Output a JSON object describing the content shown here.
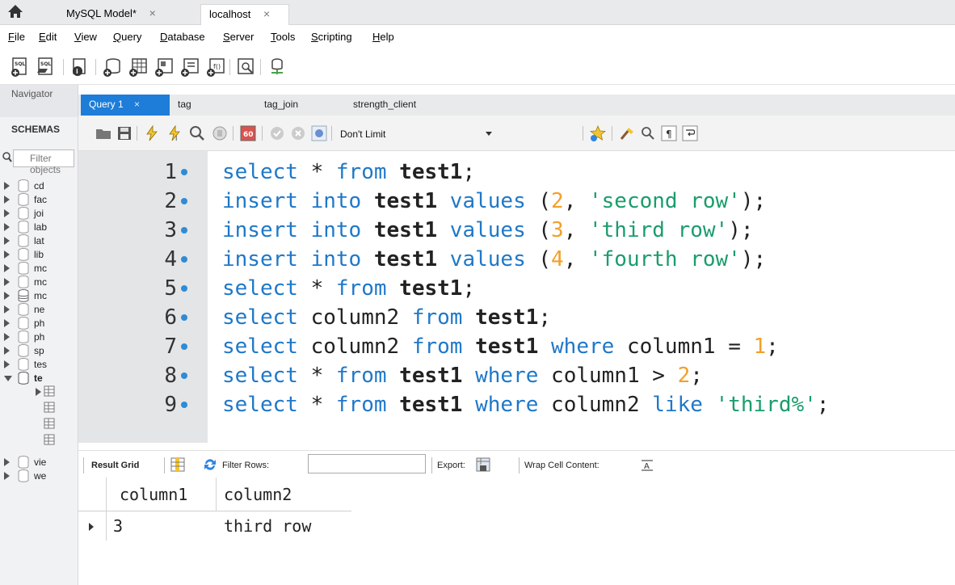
{
  "top_tabs": {
    "tabs": [
      {
        "label": "MySQL Model*",
        "close": "×"
      },
      {
        "label": "localhost",
        "close": "×"
      }
    ]
  },
  "menu": {
    "items": [
      "File",
      "Edit",
      "View",
      "Query",
      "Database",
      "Server",
      "Tools",
      "Scripting",
      "Help"
    ],
    "mnemonics": [
      "F",
      "E",
      "V",
      "Q",
      "D",
      "S",
      "T",
      "S",
      "H"
    ]
  },
  "navigator": {
    "header": "Navigator",
    "schemas_label": "SCHEMAS",
    "filter_placeholder": "Filter objects",
    "schemas": [
      "cd",
      "fac",
      "joi",
      "lab",
      "lat",
      "lib",
      "mc",
      "mc",
      "mc",
      "ne",
      "ph",
      "ph",
      "sp",
      "tes",
      "te",
      "vie",
      "we"
    ]
  },
  "query_tabs": {
    "tabs": [
      {
        "label": "Query 1",
        "close": "×",
        "active": true
      },
      {
        "label": "tag"
      },
      {
        "label": "tag_join"
      },
      {
        "label": "strength_client"
      }
    ]
  },
  "query_toolbar": {
    "limit_value": "Don't Limit"
  },
  "editor": {
    "lines": [
      {
        "n": "1",
        "tokens": [
          [
            "kw",
            "select"
          ],
          [
            "plain",
            " * "
          ],
          [
            "kw",
            "from"
          ],
          [
            "plain",
            " "
          ],
          [
            "id",
            "test1"
          ],
          [
            "plain",
            ";"
          ]
        ]
      },
      {
        "n": "2",
        "tokens": [
          [
            "kw",
            "insert"
          ],
          [
            "plain",
            " "
          ],
          [
            "kw",
            "into"
          ],
          [
            "plain",
            " "
          ],
          [
            "id",
            "test1"
          ],
          [
            "plain",
            " "
          ],
          [
            "kw",
            "values"
          ],
          [
            "plain",
            " ("
          ],
          [
            "num",
            "2"
          ],
          [
            "plain",
            ", "
          ],
          [
            "str",
            "'second row'"
          ],
          [
            "plain",
            ");"
          ]
        ]
      },
      {
        "n": "3",
        "tokens": [
          [
            "kw",
            "insert"
          ],
          [
            "plain",
            " "
          ],
          [
            "kw",
            "into"
          ],
          [
            "plain",
            " "
          ],
          [
            "id",
            "test1"
          ],
          [
            "plain",
            " "
          ],
          [
            "kw",
            "values"
          ],
          [
            "plain",
            " ("
          ],
          [
            "num",
            "3"
          ],
          [
            "plain",
            ", "
          ],
          [
            "str",
            "'third row'"
          ],
          [
            "plain",
            ");"
          ]
        ]
      },
      {
        "n": "4",
        "tokens": [
          [
            "kw",
            "insert"
          ],
          [
            "plain",
            " "
          ],
          [
            "kw",
            "into"
          ],
          [
            "plain",
            " "
          ],
          [
            "id",
            "test1"
          ],
          [
            "plain",
            " "
          ],
          [
            "kw",
            "values"
          ],
          [
            "plain",
            " ("
          ],
          [
            "num",
            "4"
          ],
          [
            "plain",
            ", "
          ],
          [
            "str",
            "'fourth row'"
          ],
          [
            "plain",
            ");"
          ]
        ]
      },
      {
        "n": "5",
        "tokens": [
          [
            "kw",
            "select"
          ],
          [
            "plain",
            " * "
          ],
          [
            "kw",
            "from"
          ],
          [
            "plain",
            " "
          ],
          [
            "id",
            "test1"
          ],
          [
            "plain",
            ";"
          ]
        ]
      },
      {
        "n": "6",
        "tokens": [
          [
            "kw",
            "select"
          ],
          [
            "plain",
            " column2 "
          ],
          [
            "kw",
            "from"
          ],
          [
            "plain",
            " "
          ],
          [
            "id",
            "test1"
          ],
          [
            "plain",
            ";"
          ]
        ]
      },
      {
        "n": "7",
        "tokens": [
          [
            "kw",
            "select"
          ],
          [
            "plain",
            " column2 "
          ],
          [
            "kw",
            "from"
          ],
          [
            "plain",
            " "
          ],
          [
            "id",
            "test1"
          ],
          [
            "plain",
            " "
          ],
          [
            "kw",
            "where"
          ],
          [
            "plain",
            " column1 = "
          ],
          [
            "num",
            "1"
          ],
          [
            "plain",
            ";"
          ]
        ]
      },
      {
        "n": "8",
        "tokens": [
          [
            "kw",
            "select"
          ],
          [
            "plain",
            " * "
          ],
          [
            "kw",
            "from"
          ],
          [
            "plain",
            " "
          ],
          [
            "id",
            "test1"
          ],
          [
            "plain",
            " "
          ],
          [
            "kw",
            "where"
          ],
          [
            "plain",
            " column1 > "
          ],
          [
            "num",
            "2"
          ],
          [
            "plain",
            ";"
          ]
        ]
      },
      {
        "n": "9",
        "tokens": [
          [
            "kw",
            "select"
          ],
          [
            "plain",
            " * "
          ],
          [
            "kw",
            "from"
          ],
          [
            "plain",
            " "
          ],
          [
            "id",
            "test1"
          ],
          [
            "plain",
            " "
          ],
          [
            "kw",
            "where"
          ],
          [
            "plain",
            " column2 "
          ],
          [
            "kw",
            "like"
          ],
          [
            "plain",
            " "
          ],
          [
            "str",
            "'third%'"
          ],
          [
            "plain",
            ";"
          ]
        ]
      }
    ]
  },
  "result_toolbar": {
    "result_grid": "Result Grid",
    "filter_rows": "Filter Rows:",
    "export": "Export:",
    "wrap": "Wrap Cell Content:"
  },
  "result_grid": {
    "columns": [
      "column1",
      "column2"
    ],
    "rows": [
      [
        "3",
        "third row"
      ]
    ]
  }
}
